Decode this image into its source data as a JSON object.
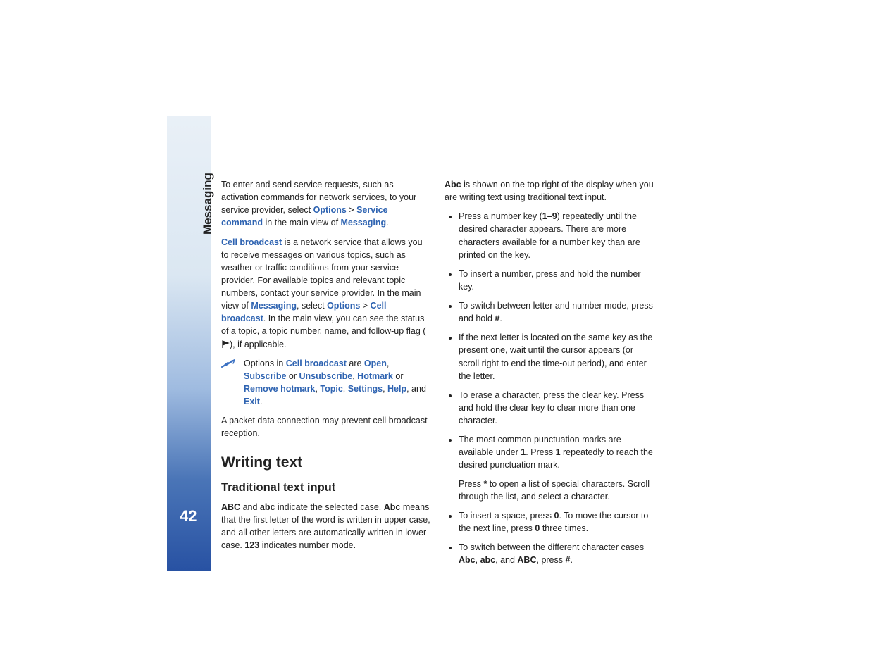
{
  "sectionLabel": "Messaging",
  "pageNumber": "42",
  "p1_a": "To enter and send service requests, such as activation commands for network services, to your service provider, select ",
  "p1_opt": "Options",
  "p1_gt": " > ",
  "p1_sc": "Service command",
  "p1_b": " in the main view of ",
  "p1_msg": "Messaging",
  "p1_end": ".",
  "p2_cb": "Cell broadcast",
  "p2_a": " is a network service that allows you to receive messages on various topics, such as weather or traffic conditions from your service provider. For available topics and relevant topic numbers, contact your service provider. In the main view of ",
  "p2_msg": "Messaging",
  "p2_b": ", select ",
  "p2_opt": "Options",
  "p2_gt": " > ",
  "p2_cb2": "Cell broadcast",
  "p2_c": ". In the main view, you can see the status of a topic, a topic number, name, and follow-up flag (",
  "p2_d": "), if applicable.",
  "tip_a": "Options in ",
  "tip_cb": "Cell broadcast",
  "tip_are": " are ",
  "tip_open": "Open",
  "tip_comma": ", ",
  "tip_sub": "Subscribe",
  "tip_or": " or ",
  "tip_unsub": "Unsubscribe",
  "tip_hm": "Hotmark",
  "tip_rhm": "Remove hotmark",
  "tip_topic": "Topic",
  "tip_settings": "Settings",
  "tip_help": "Help",
  "tip_and": ", and ",
  "tip_exit": "Exit",
  "tip_end": ".",
  "p3": "A packet data connection may prevent cell broadcast reception.",
  "h2": "Writing text",
  "h3": "Traditional text input",
  "p4_ABC": "ABC",
  "p4_and": " and ",
  "p4_abc": "abc",
  "p4_a": " indicate the selected case. ",
  "p4_Abc": "Abc",
  "p4_b": " means that the first letter of the word is written in upper case, and all other letters are automatically written in lower case. ",
  "p4_123": "123",
  "p4_c": " indicates number mode.",
  "p5_Abc": "Abc",
  "p5": " is shown on the top right of the display when you are writing text using traditional text input.",
  "b1_a": "Press a number key (",
  "b1_keys": "1–9",
  "b1_b": ") repeatedly until the desired character appears. There are more characters available for a number key than are printed on the key.",
  "b2": "To insert a number, press and hold the number key.",
  "b3_a": "To switch between letter and number mode, press and hold ",
  "b3_hash": "#",
  "b3_b": ".",
  "b4": "If the next letter is located on the same key as the present one, wait until the cursor appears (or scroll right to end the time-out period), and enter the letter.",
  "b5": "To erase a character, press the clear key. Press and hold the clear key to clear more than one character.",
  "b6_a": "The most common punctuation marks are available under ",
  "b6_1a": "1",
  "b6_b": ". Press ",
  "b6_1b": "1",
  "b6_c": " repeatedly to reach the desired punctuation mark.",
  "b6s_a": "Press ",
  "b6s_star": "*",
  "b6s_b": " to open a list of special characters. Scroll through the list, and select a character.",
  "b7_a": "To insert a space, press ",
  "b7_0a": "0",
  "b7_b": ". To move the cursor to the next line, press ",
  "b7_0b": "0",
  "b7_c": " three times.",
  "b8_a": "To switch between the different character cases ",
  "b8_Abc": "Abc",
  "b8_c1": ", ",
  "b8_abc": "abc",
  "b8_and": ", and ",
  "b8_ABC": "ABC",
  "b8_b": ", press ",
  "b8_hash": "#",
  "b8_end": "."
}
